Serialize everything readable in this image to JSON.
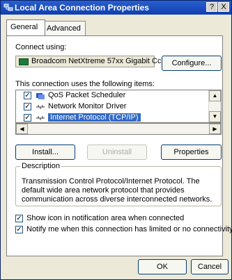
{
  "window": {
    "title": "Local Area Connection Properties",
    "help_label": "?",
    "close_label": "X"
  },
  "tabs": [
    {
      "label": "General",
      "active": true
    },
    {
      "label": "Advanced",
      "active": false
    }
  ],
  "connect_using": {
    "label": "Connect using:",
    "adapter": "Broadcom NetXtreme 57xx Gigabit Cc",
    "configure_label": "Configure..."
  },
  "components": {
    "label": "This connection uses the following items:",
    "items": [
      {
        "label": "QoS Packet Scheduler",
        "checked": true,
        "icon": "qos-icon"
      },
      {
        "label": "Network Monitor Driver",
        "checked": true,
        "icon": "network-icon"
      },
      {
        "label": "Internet Protocol (TCP/IP)",
        "checked": true,
        "icon": "network-icon",
        "selected": true
      }
    ]
  },
  "buttons": {
    "install": "Install...",
    "uninstall": "Uninstall",
    "properties": "Properties",
    "ok": "OK",
    "cancel": "Cancel"
  },
  "description": {
    "title": "Description",
    "text": "Transmission Control Protocol/Internet Protocol. The default wide area network protocol that provides communication across diverse interconnected networks."
  },
  "options": [
    {
      "label": "Show icon in notification area when connected",
      "checked": true
    },
    {
      "label": "Notify me when this connection has limited or no connectivity",
      "checked": true
    }
  ]
}
